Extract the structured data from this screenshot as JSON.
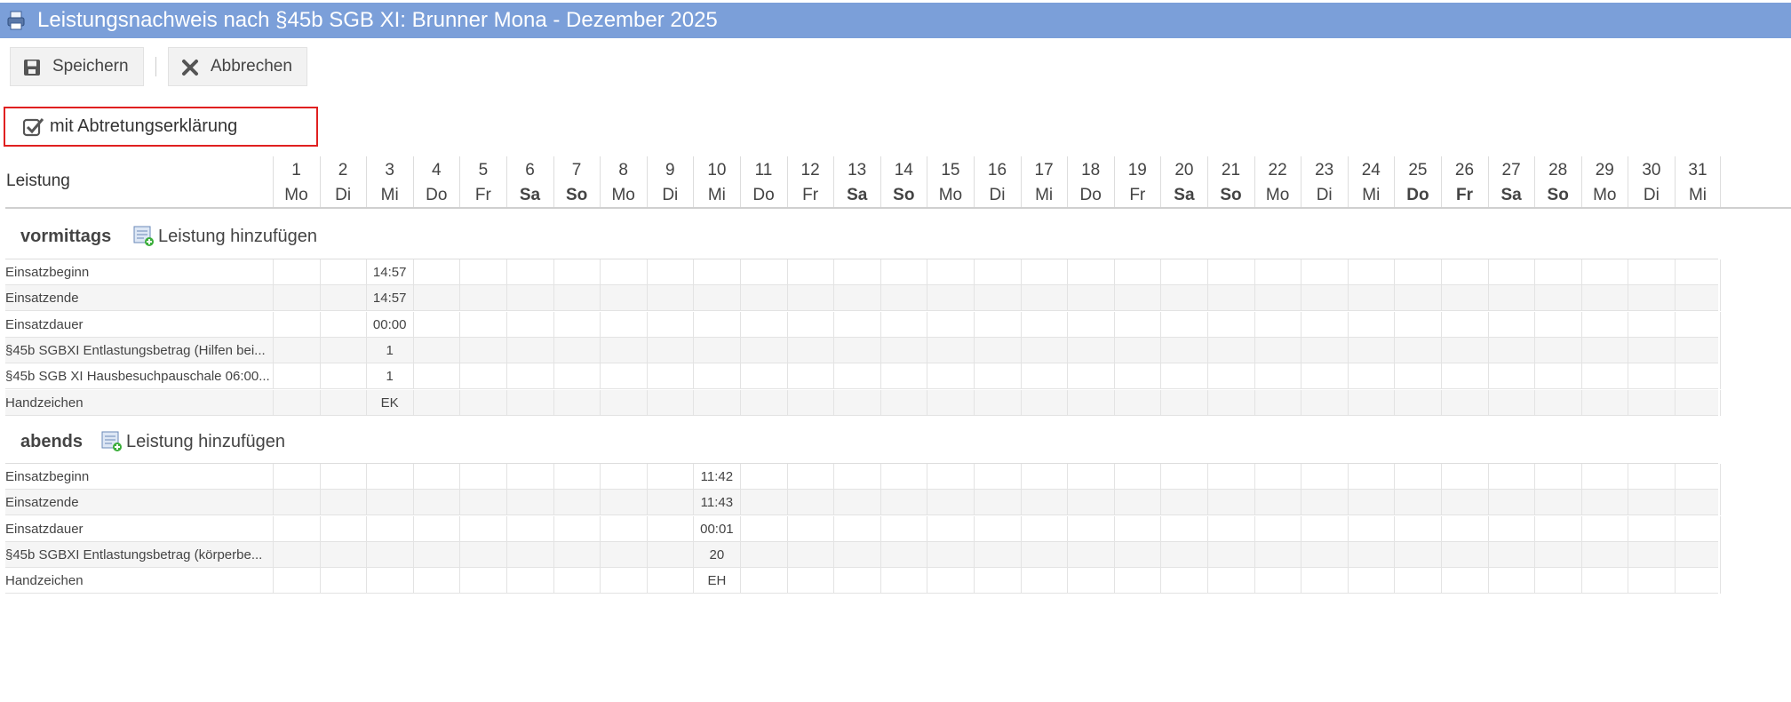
{
  "window": {
    "title": "Leistungsnachweis nach §45b SGB XI: Brunner Mona - Dezember 2025"
  },
  "toolbar": {
    "save_label": "Speichern",
    "cancel_label": "Abbrechen"
  },
  "assignment": {
    "label": "mit Abtretungserklärung",
    "checked": true
  },
  "table": {
    "leistung_header": "Leistung",
    "add_label": "Leistung hinzufügen",
    "days": [
      {
        "n": "1",
        "wd": "Mo",
        "bold": false
      },
      {
        "n": "2",
        "wd": "Di",
        "bold": false
      },
      {
        "n": "3",
        "wd": "Mi",
        "bold": false
      },
      {
        "n": "4",
        "wd": "Do",
        "bold": false
      },
      {
        "n": "5",
        "wd": "Fr",
        "bold": false
      },
      {
        "n": "6",
        "wd": "Sa",
        "bold": true
      },
      {
        "n": "7",
        "wd": "So",
        "bold": true
      },
      {
        "n": "8",
        "wd": "Mo",
        "bold": false
      },
      {
        "n": "9",
        "wd": "Di",
        "bold": false
      },
      {
        "n": "10",
        "wd": "Mi",
        "bold": false
      },
      {
        "n": "11",
        "wd": "Do",
        "bold": false
      },
      {
        "n": "12",
        "wd": "Fr",
        "bold": false
      },
      {
        "n": "13",
        "wd": "Sa",
        "bold": true
      },
      {
        "n": "14",
        "wd": "So",
        "bold": true
      },
      {
        "n": "15",
        "wd": "Mo",
        "bold": false
      },
      {
        "n": "16",
        "wd": "Di",
        "bold": false
      },
      {
        "n": "17",
        "wd": "Mi",
        "bold": false
      },
      {
        "n": "18",
        "wd": "Do",
        "bold": false
      },
      {
        "n": "19",
        "wd": "Fr",
        "bold": false
      },
      {
        "n": "20",
        "wd": "Sa",
        "bold": true
      },
      {
        "n": "21",
        "wd": "So",
        "bold": true
      },
      {
        "n": "22",
        "wd": "Mo",
        "bold": false
      },
      {
        "n": "23",
        "wd": "Di",
        "bold": false
      },
      {
        "n": "24",
        "wd": "Mi",
        "bold": false
      },
      {
        "n": "25",
        "wd": "Do",
        "bold": true
      },
      {
        "n": "26",
        "wd": "Fr",
        "bold": true
      },
      {
        "n": "27",
        "wd": "Sa",
        "bold": true
      },
      {
        "n": "28",
        "wd": "So",
        "bold": true
      },
      {
        "n": "29",
        "wd": "Mo",
        "bold": false
      },
      {
        "n": "30",
        "wd": "Di",
        "bold": false
      },
      {
        "n": "31",
        "wd": "Mi",
        "bold": false
      }
    ],
    "sections": [
      {
        "title": "vormittags",
        "rows": [
          {
            "label": "Einsatzbeginn",
            "values": {
              "3": "14:57"
            }
          },
          {
            "label": "Einsatzende",
            "values": {
              "3": "14:57"
            }
          },
          {
            "label": "Einsatzdauer",
            "values": {
              "3": "00:00"
            }
          },
          {
            "label": "§45b SGBXI Entlastungsbetrag (Hilfen bei...",
            "values": {
              "3": "1"
            }
          },
          {
            "label": "§45b SGB XI Hausbesuchpauschale 06:00...",
            "values": {
              "3": "1"
            }
          },
          {
            "label": "Handzeichen",
            "values": {
              "3": "EK"
            }
          }
        ]
      },
      {
        "title": "abends",
        "rows": [
          {
            "label": "Einsatzbeginn",
            "values": {
              "10": "11:42"
            }
          },
          {
            "label": "Einsatzende",
            "values": {
              "10": "11:43"
            }
          },
          {
            "label": "Einsatzdauer",
            "values": {
              "10": "00:01"
            }
          },
          {
            "label": "§45b SGBXI Entlastungsbetrag (körperbe...",
            "values": {
              "10": "20"
            }
          },
          {
            "label": "Handzeichen",
            "values": {
              "10": "EH"
            }
          }
        ]
      }
    ]
  }
}
